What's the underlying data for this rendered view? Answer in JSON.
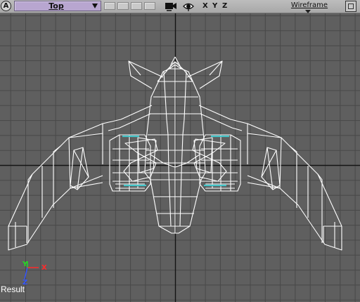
{
  "toolbar": {
    "viewport_badge": "A",
    "view_name": "Top",
    "axes": [
      "X",
      "Y",
      "Z"
    ],
    "render_mode": "Wireframe"
  },
  "viewport": {
    "result_label": "Result",
    "gizmo_labels": {
      "y": "Y",
      "x": "X",
      "z": "Z"
    }
  },
  "colors": {
    "grid_bg": "#5f5f5f",
    "grid_line": "#484848",
    "axis_line": "#141414",
    "wire": "#ffffff",
    "highlight": "#43c4c8",
    "view_select": "#b8a6d0",
    "gizmo_x": "#ff2a2a",
    "gizmo_y": "#22dd22",
    "gizmo_z": "#3355ff"
  },
  "icons": [
    "camera-icon",
    "eye-icon",
    "maximize-icon"
  ]
}
